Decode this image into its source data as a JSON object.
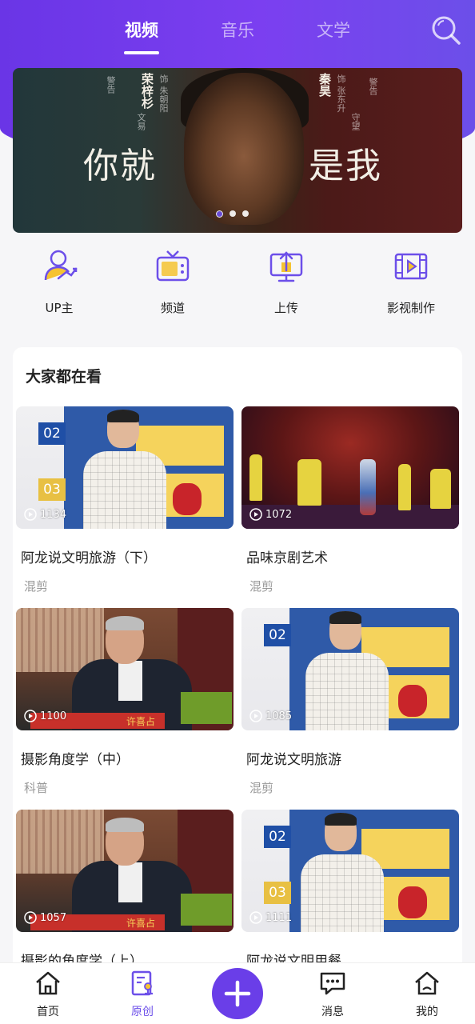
{
  "tabs": [
    {
      "label": "视频",
      "active": true
    },
    {
      "label": "音乐",
      "active": false
    },
    {
      "label": "文学",
      "active": false
    }
  ],
  "banner": {
    "title_left": "你就",
    "title_right": "是我",
    "name_left": "荣梓杉",
    "name_right": "秦昊",
    "credit_left_1": "饰 朱朝阳",
    "credit_right_1": "饰 张东升",
    "credit_far_left": "警告",
    "credit_left_2": "文易",
    "credit_far_right": "警告",
    "credit_right_2": "守望"
  },
  "quick_actions": [
    {
      "label": "UP主",
      "icon": "up-user-icon"
    },
    {
      "label": "频道",
      "icon": "tv-channel-icon"
    },
    {
      "label": "上传",
      "icon": "upload-icon"
    },
    {
      "label": "影视制作",
      "icon": "film-icon"
    }
  ],
  "section": {
    "title": "大家都在看"
  },
  "videos": [
    {
      "title": "阿龙说文明旅游（下）",
      "tag": "混剪",
      "views": "1134"
    },
    {
      "title": "品味京剧艺术",
      "tag": "混剪",
      "views": "1072"
    },
    {
      "title": "摄影角度学（中）",
      "tag": "科普",
      "views": "1100"
    },
    {
      "title": "阿龙说文明旅游",
      "tag": "混剪",
      "views": "1085"
    },
    {
      "title": "摄影的角度学（上）",
      "tag": "",
      "views": "1057"
    },
    {
      "title": "阿龙说文明用餐",
      "tag": "",
      "views": "1111"
    }
  ],
  "thumb_text": {
    "board_top": "02",
    "board_bottom": "03",
    "banner_name": "许喜占"
  },
  "nav": [
    {
      "label": "首页",
      "icon": "home-icon",
      "active": false
    },
    {
      "label": "原创",
      "icon": "original-icon",
      "active": true
    },
    {
      "label": "消息",
      "icon": "message-icon",
      "active": false
    },
    {
      "label": "我的",
      "icon": "profile-home-icon",
      "active": false
    }
  ],
  "colors": {
    "accent": "#6c4fe9",
    "header_start": "#6a35e6",
    "header_end": "#6c4fe9"
  }
}
